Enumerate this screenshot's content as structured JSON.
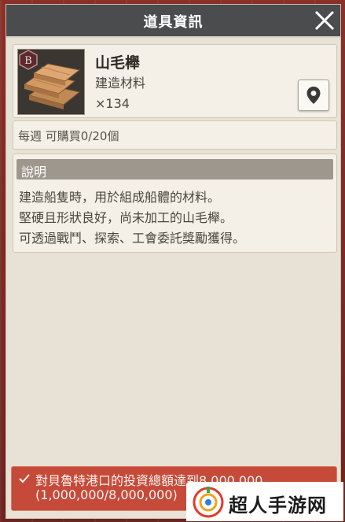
{
  "header": {
    "title": "道具資訊"
  },
  "item": {
    "name": "山毛櫸",
    "category": "建造材料",
    "count": "×134",
    "rarity": "B"
  },
  "weekly": {
    "text": "每週 可購買0/20個"
  },
  "description": {
    "header": "說明",
    "lines": [
      "建造船隻時，用於組成船體的材料。",
      "堅硬且形狀良好，尚未加工的山毛櫸。",
      "可透過戰鬥、探索、工會委託獎勵獲得。"
    ]
  },
  "quest": {
    "line1": "對貝魯特港口的投資總額達到8,000,000",
    "line2": "(1,000,000/8,000,000)"
  },
  "watermark": {
    "text": "超人手游网"
  },
  "colors": {
    "header_bg": "#4a4c4e",
    "panel_bg": "#f4f0e8",
    "quest_bg": "#c64a3a",
    "desc_header_bg": "#9e978d"
  }
}
